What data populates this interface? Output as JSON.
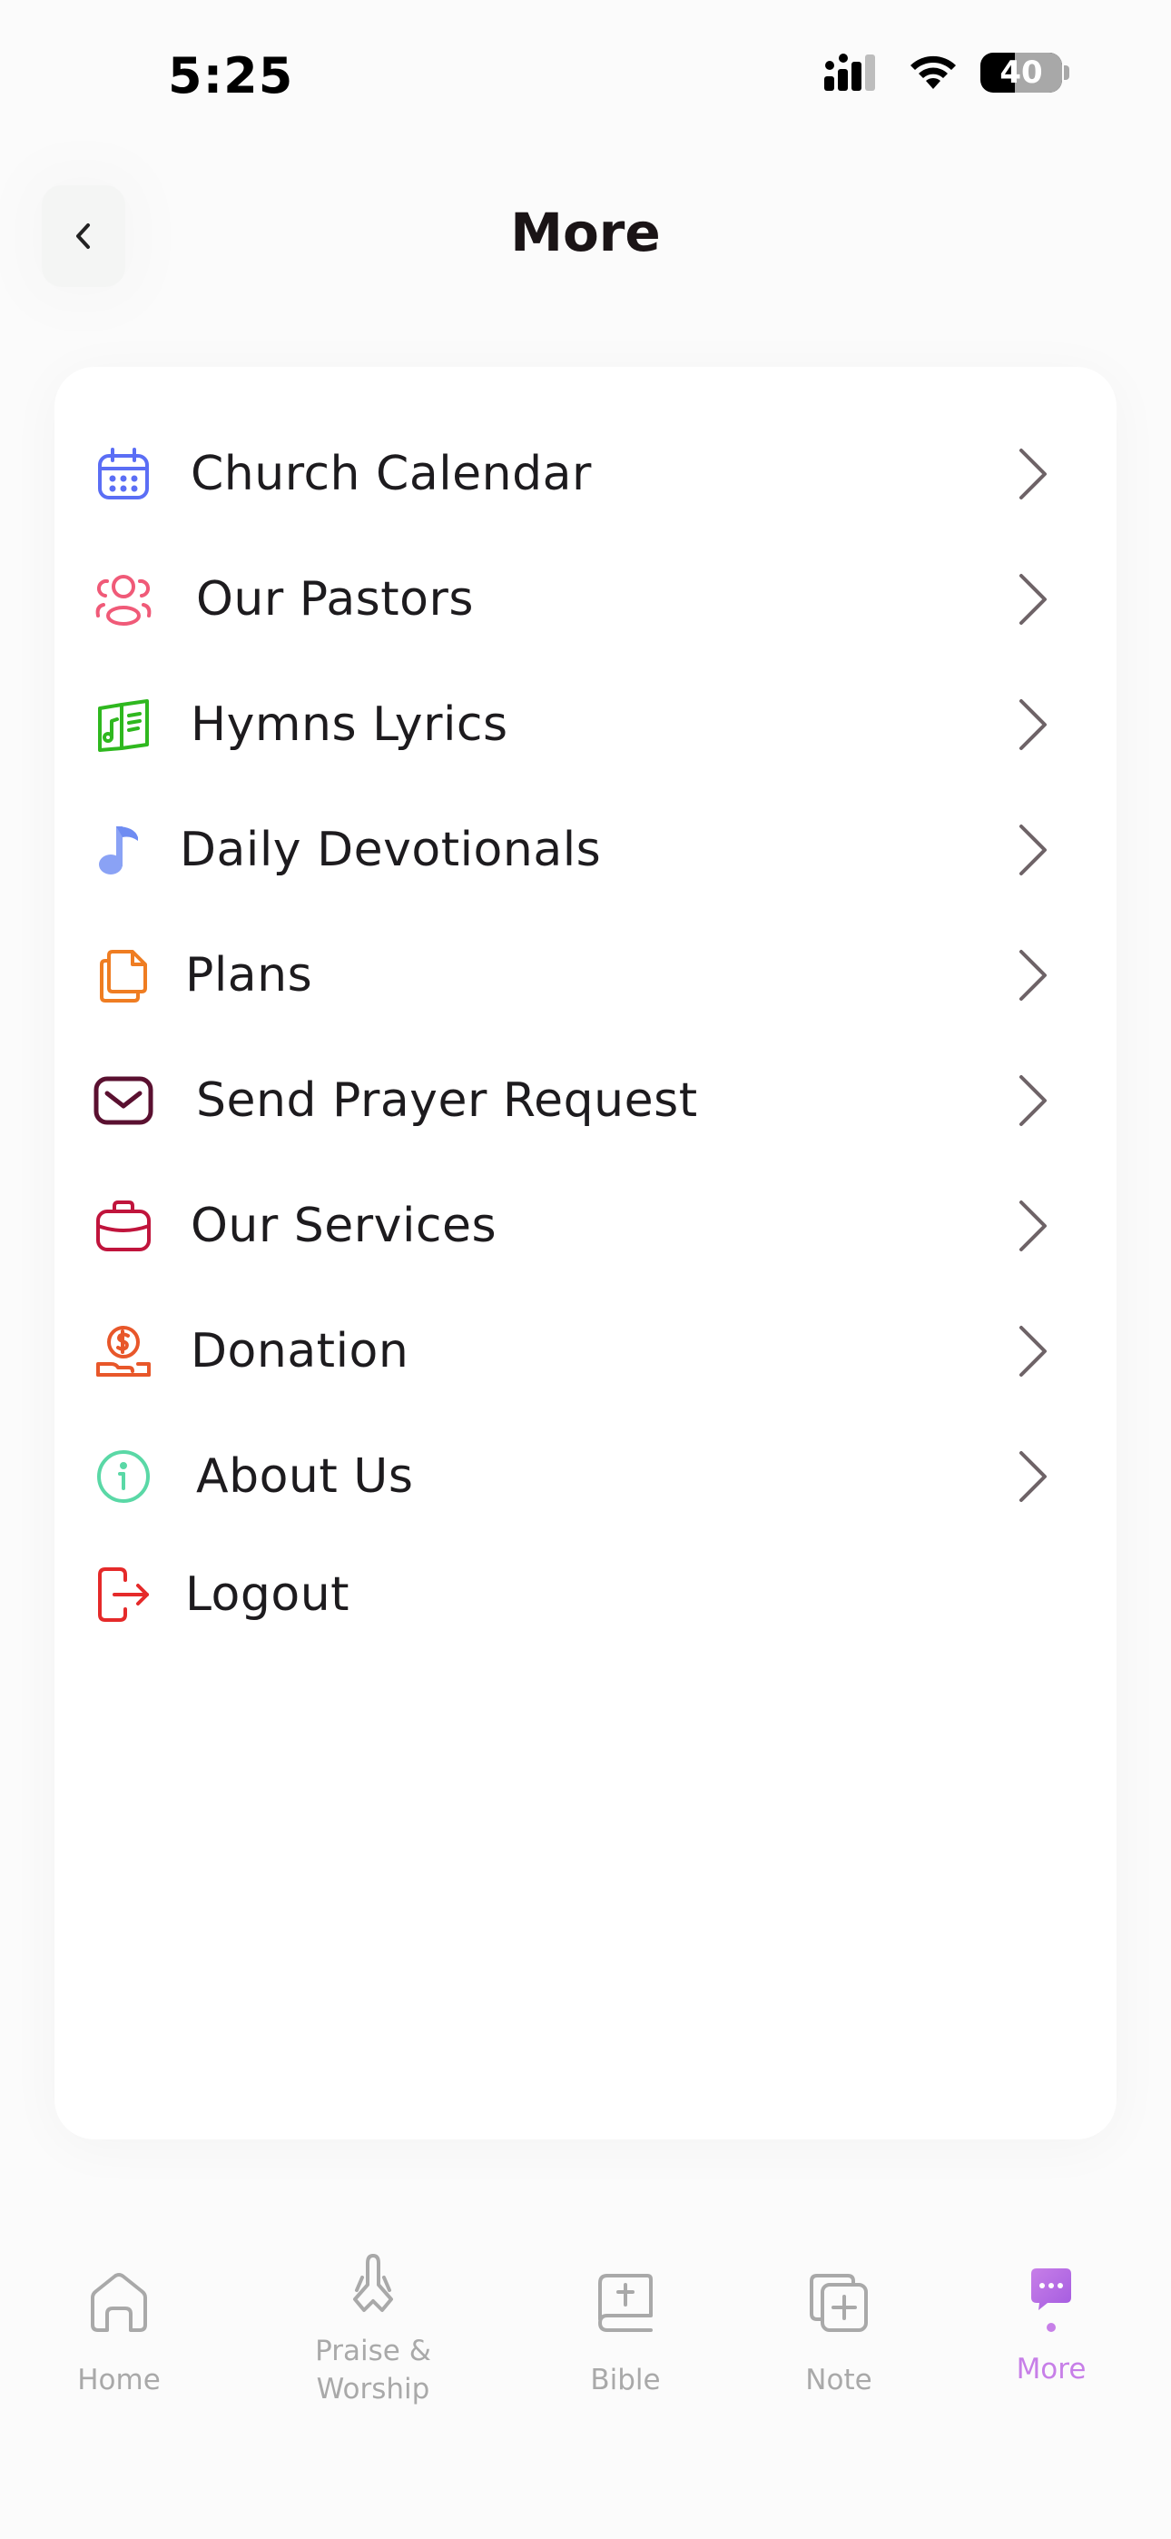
{
  "status_bar": {
    "time": "5:25",
    "battery_level": "40"
  },
  "header": {
    "title": "More",
    "back_icon": "chevron-left-icon"
  },
  "menu": {
    "items": [
      {
        "label": "Church Calendar",
        "icon": "calendar-icon",
        "color": "#5b6ef5"
      },
      {
        "label": "Our Pastors",
        "icon": "people-icon",
        "color": "#f05a78"
      },
      {
        "label": "Hymns Lyrics",
        "icon": "lyrics-book-icon",
        "color": "#2fb81f"
      },
      {
        "label": "Daily Devotionals",
        "icon": "music-note-icon",
        "color": "#8aa2f5"
      },
      {
        "label": "Plans",
        "icon": "documents-icon",
        "color": "#ef7d22"
      },
      {
        "label": "Send Prayer Request",
        "icon": "envelope-icon",
        "color": "#5a1030"
      },
      {
        "label": "Our Services",
        "icon": "briefcase-icon",
        "color": "#c0143c"
      },
      {
        "label": "Donation",
        "icon": "donation-coin-icon",
        "color": "#e8572a"
      },
      {
        "label": "About Us",
        "icon": "info-icon",
        "color": "#5ad8a6"
      },
      {
        "label": "Logout",
        "icon": "logout-icon",
        "color": "#e52a2a"
      }
    ]
  },
  "tab_bar": {
    "tabs": [
      {
        "label": "Home",
        "icon": "home-icon"
      },
      {
        "label": "Praise & Worship",
        "icon": "praying-hands-icon"
      },
      {
        "label": "Bible",
        "icon": "bible-icon"
      },
      {
        "label": "Note",
        "icon": "note-add-icon"
      },
      {
        "label": "More",
        "icon": "more-chat-icon",
        "active": true
      }
    ],
    "active_color": "#c77fe8",
    "inactive_color": "#a9a9a9"
  }
}
